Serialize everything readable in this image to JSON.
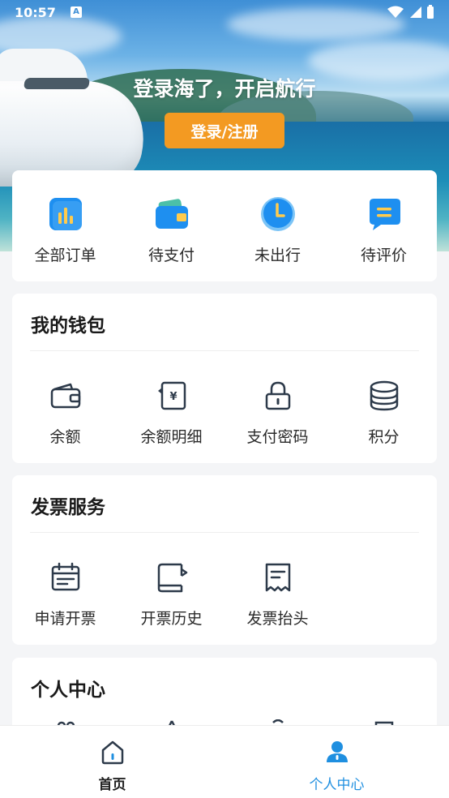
{
  "status_bar": {
    "time": "10:57",
    "notification": "A"
  },
  "hero": {
    "title": "登录海了，开启航行",
    "login_button": "登录/注册"
  },
  "orders": {
    "items": [
      {
        "label": "全部订单",
        "icon": "bar-chart-icon"
      },
      {
        "label": "待支付",
        "icon": "wallet-icon"
      },
      {
        "label": "未出行",
        "icon": "clock-icon"
      },
      {
        "label": "待评价",
        "icon": "chat-icon"
      }
    ]
  },
  "wallet": {
    "title": "我的钱包",
    "items": [
      {
        "label": "余额",
        "icon": "wallet-outline-icon"
      },
      {
        "label": "余额明细",
        "icon": "yuan-receipt-icon"
      },
      {
        "label": "支付密码",
        "icon": "lock-icon"
      },
      {
        "label": "积分",
        "icon": "coins-stack-icon"
      }
    ]
  },
  "invoice": {
    "title": "发票服务",
    "items": [
      {
        "label": "申请开票",
        "icon": "calendar-icon"
      },
      {
        "label": "开票历史",
        "icon": "book-history-icon"
      },
      {
        "label": "发票抬头",
        "icon": "receipt-icon"
      }
    ]
  },
  "personal": {
    "title": "个人中心"
  },
  "bottom_nav": {
    "items": [
      {
        "label": "首页",
        "icon": "home-icon",
        "active": false
      },
      {
        "label": "个人中心",
        "icon": "user-icon",
        "active": true
      }
    ]
  },
  "colors": {
    "accent": "#1f8fe0",
    "login_button": "#f39a22",
    "icon_dark": "#2d3a4a"
  }
}
